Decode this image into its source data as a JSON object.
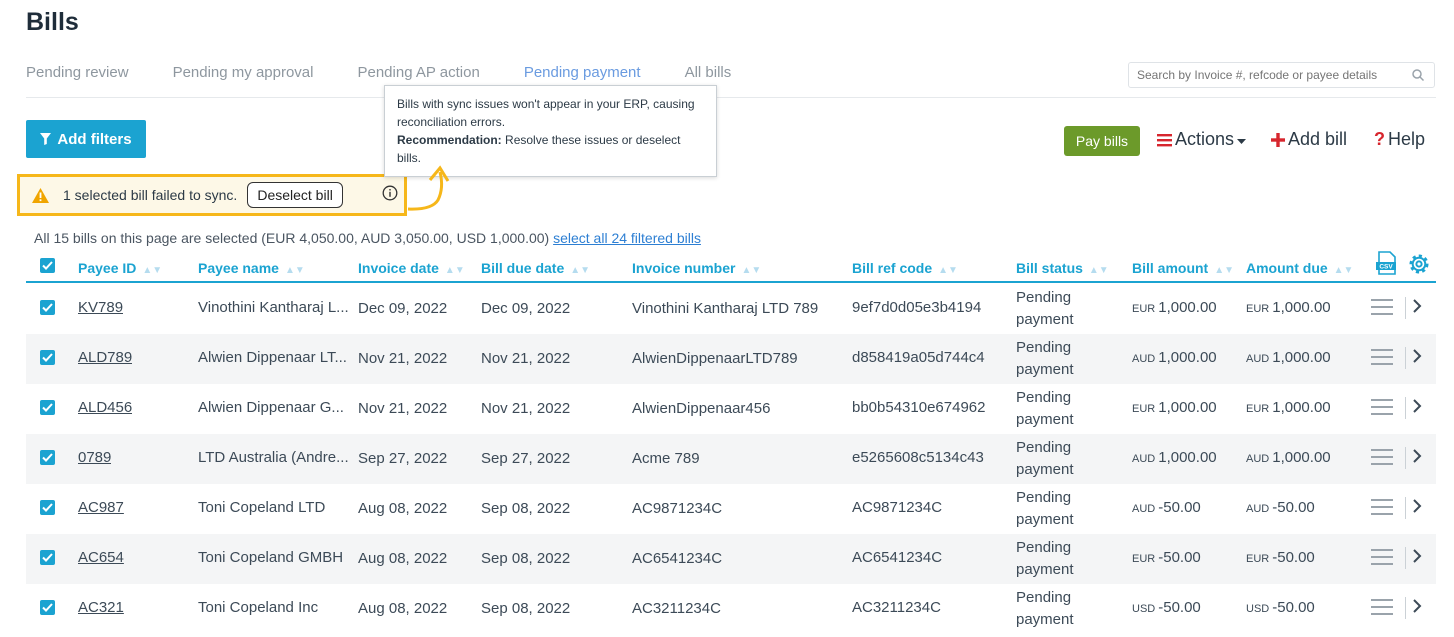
{
  "page": {
    "title": "Bills"
  },
  "tabs": [
    {
      "label": "Pending review",
      "active": false
    },
    {
      "label": "Pending my approval",
      "active": false
    },
    {
      "label": "Pending AP action",
      "active": false
    },
    {
      "label": "Pending payment",
      "active": true
    },
    {
      "label": "All bills",
      "active": false
    }
  ],
  "search": {
    "placeholder": "Search by Invoice #, refcode or payee details"
  },
  "toolbar": {
    "add_filters": "Add filters",
    "pay_bills": "Pay bills",
    "actions": "Actions",
    "add_bill": "Add bill",
    "help": "Help"
  },
  "tooltip": {
    "line1": "Bills with sync issues won't appear in your ERP, causing reconciliation errors.",
    "rec_label": "Recommendation:",
    "rec_text": " Resolve these issues or deselect bills."
  },
  "warning": {
    "message": "1 selected bill failed to sync.",
    "deselect": "Deselect bill"
  },
  "selection": {
    "note": "All 15 bills on this page are selected (EUR 4,050.00, AUD 3,050.00, USD 1,000.00)",
    "link": "select all 24 filtered bills"
  },
  "columns": {
    "payee_id": "Payee ID",
    "payee_name": "Payee name",
    "invoice_date": "Invoice date",
    "due_date": "Bill due date",
    "invoice_number": "Invoice number",
    "ref_code": "Bill ref code",
    "status": "Bill status",
    "amount": "Bill amount",
    "amount_due": "Amount due"
  },
  "status_lines": [
    "Pending",
    "payment"
  ],
  "rows": [
    {
      "payee_id": "KV789",
      "payee_name": "Vinothini Kantharaj L...",
      "invoice_date": "Dec 09, 2022",
      "due_date": "Dec 09, 2022",
      "invoice_number": "Vinothini Kantharaj LTD 789",
      "ref_code": "9ef7d0d05e3b4194",
      "currency": "EUR",
      "amount": "1,000.00",
      "amount_due": "1,000.00"
    },
    {
      "payee_id": "ALD789",
      "payee_name": "Alwien Dippenaar LT...",
      "invoice_date": "Nov 21, 2022",
      "due_date": "Nov 21, 2022",
      "invoice_number": "AlwienDippenaarLTD789",
      "ref_code": "d858419a05d744c4",
      "currency": "AUD",
      "amount": "1,000.00",
      "amount_due": "1,000.00"
    },
    {
      "payee_id": "ALD456",
      "payee_name": "Alwien Dippenaar G...",
      "invoice_date": "Nov 21, 2022",
      "due_date": "Nov 21, 2022",
      "invoice_number": "AlwienDippenaar456",
      "ref_code": "bb0b54310e674962",
      "currency": "EUR",
      "amount": "1,000.00",
      "amount_due": "1,000.00"
    },
    {
      "payee_id": "0789",
      "payee_name": "LTD Australia (Andre...",
      "invoice_date": "Sep 27, 2022",
      "due_date": "Sep 27, 2022",
      "invoice_number": "Acme 789",
      "ref_code": "e5265608c5134c43",
      "currency": "AUD",
      "amount": "1,000.00",
      "amount_due": "1,000.00"
    },
    {
      "payee_id": "AC987",
      "payee_name": "Toni Copeland LTD",
      "invoice_date": "Aug 08, 2022",
      "due_date": "Sep 08, 2022",
      "invoice_number": "AC9871234C",
      "ref_code": "AC9871234C",
      "currency": "AUD",
      "amount": "-50.00",
      "amount_due": "-50.00"
    },
    {
      "payee_id": "AC654",
      "payee_name": "Toni Copeland GMBH",
      "invoice_date": "Aug 08, 2022",
      "due_date": "Sep 08, 2022",
      "invoice_number": "AC6541234C",
      "ref_code": "AC6541234C",
      "currency": "EUR",
      "amount": "-50.00",
      "amount_due": "-50.00"
    },
    {
      "payee_id": "AC321",
      "payee_name": "Toni Copeland Inc",
      "invoice_date": "Aug 08, 2022",
      "due_date": "Sep 08, 2022",
      "invoice_number": "AC3211234C",
      "ref_code": "AC3211234C",
      "currency": "USD",
      "amount": "-50.00",
      "amount_due": "-50.00"
    }
  ],
  "colors": {
    "accent": "#1ba3d1",
    "pay": "#6c9a2a",
    "warning": "#f6b71a",
    "link": "#2d7fd3",
    "danger": "#d7262e"
  },
  "icons": [
    "filter-icon",
    "search-icon",
    "warning-icon",
    "info-icon",
    "csv-icon",
    "gear-icon",
    "menu-icon",
    "chevron-right-icon",
    "plus-icon",
    "hamburger-icon",
    "question-icon",
    "checkbox-icon"
  ]
}
